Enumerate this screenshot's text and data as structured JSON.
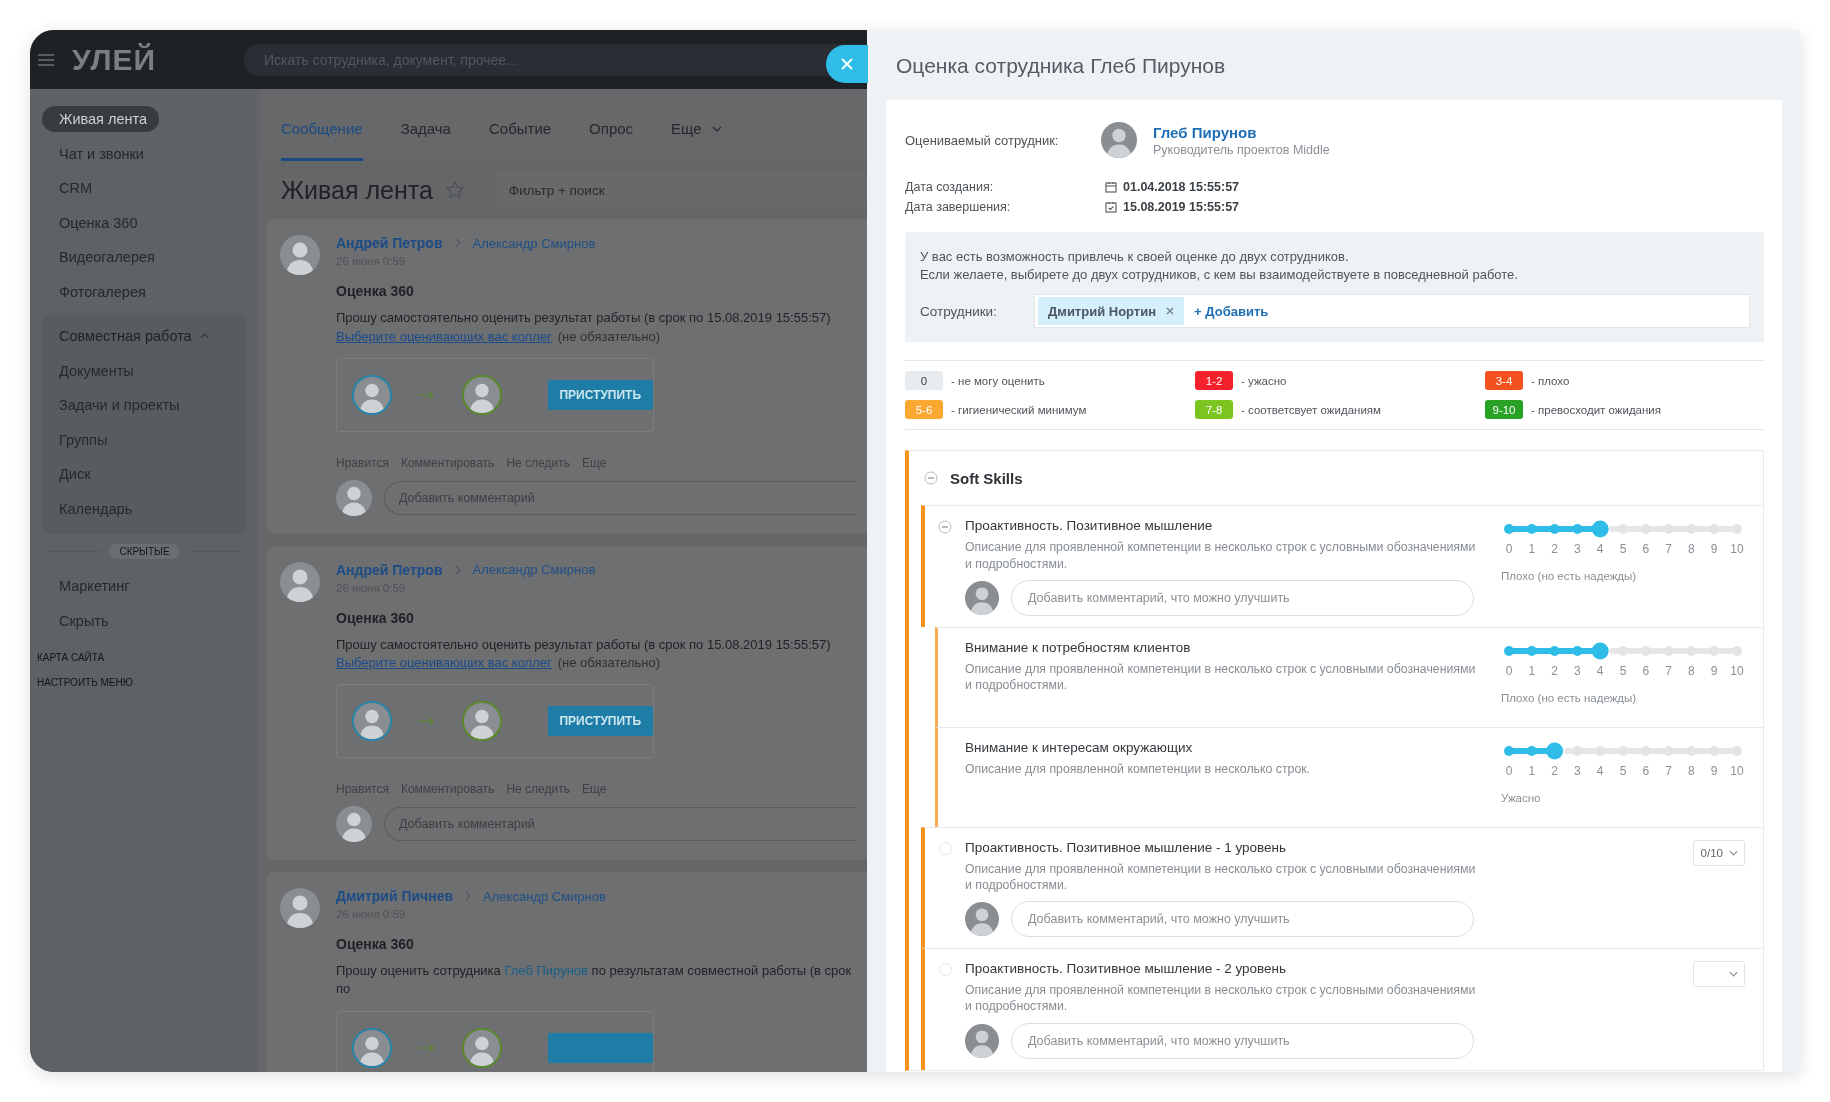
{
  "topbar": {
    "logo": "УЛЕЙ",
    "search_placeholder": "Искать сотрудника, документ, прочее..."
  },
  "sidebar": {
    "items": [
      {
        "label": "Живая лента",
        "selected": true
      },
      {
        "label": "Чат и звонки",
        "selected": false
      },
      {
        "label": "CRM",
        "selected": false
      },
      {
        "label": "Оценка 360",
        "selected": false
      },
      {
        "label": "Видеогалерея",
        "selected": false
      },
      {
        "label": "Фотогалерея",
        "selected": false
      }
    ],
    "group": {
      "label": "Совместная работа",
      "expanded": true,
      "children": [
        {
          "label": "Документы",
          "selected": false
        },
        {
          "label": "Задачи и проекты",
          "selected": false
        },
        {
          "label": "Группы",
          "selected": false
        },
        {
          "label": "Диск",
          "selected": false
        },
        {
          "label": "Календарь",
          "selected": false
        }
      ]
    },
    "divider": "СКРЫТЫЕ",
    "hidden_items": [
      {
        "label": "Маркетинг",
        "selected": false
      },
      {
        "label": "Скрыть",
        "selected": false
      }
    ],
    "footer_links": [
      "КАРТА САЙТА",
      "НАСТРОИТЬ МЕНЮ"
    ]
  },
  "composer_tabs": [
    {
      "label": "Сообщение",
      "selected": true,
      "menu": false
    },
    {
      "label": "Задача",
      "selected": false,
      "menu": false
    },
    {
      "label": "Событие",
      "selected": false,
      "menu": false
    },
    {
      "label": "Опрос",
      "selected": false,
      "menu": false
    },
    {
      "label": "Еще",
      "selected": false,
      "menu": true
    }
  ],
  "feed": {
    "title": "Живая лента",
    "starred": false,
    "filter_placeholder": "Фильтр + поиск",
    "posts": [
      {
        "author": "Андрей Петров",
        "recipient": "Александр Смирнов",
        "time": "26 июня 0:59",
        "title": "Оценка 360",
        "text": "Прошу самостоятельно оценить результат работы (в срок по 15.08.2019 15:55:57)",
        "link": "Выберите оценивающих вас коллег",
        "link_note": "(не обязательно)",
        "evaluation": true,
        "action": "ПРИСТУПИТЬ",
        "actions": [
          "Нравится",
          "Комментировать",
          "Не следить",
          "Еще"
        ],
        "comment_placeholder": "Добавить комментарий"
      },
      {
        "author": "Андрей Петров",
        "recipient": "Александр Смирнов",
        "time": "26 июня 0:59",
        "title": "Оценка 360",
        "text": "Прошу самостоятельно оценить результат работы (в срок по 15.08.2019 15:55:57)",
        "link": "Выберите оценивающих вас коллег",
        "link_note": "(не обязательно)",
        "evaluation": true,
        "action": "ПРИСТУПИТЬ",
        "actions": [
          "Нравится",
          "Комментировать",
          "Не следить",
          "Еще"
        ],
        "comment_placeholder": "Добавить комментарий"
      },
      {
        "author": "Дмитрий Пичнев",
        "recipient": "Александр Смирнов",
        "time": "26 июня 0:59",
        "title": "Оценка 360",
        "text": "Прошу оценить сотрудника",
        "text_link": "Глеб Пирунов",
        "text_end": "по результатам совместной работы (в срок по",
        "evaluation": true
      }
    ]
  },
  "review": {
    "title": "Оценка сотрудника Глеб Пирунов",
    "subject_label": "Оцениваемый сотрудник:",
    "subject": {
      "name": "Глеб Пирунов",
      "role": "Руководитель проектов Middle"
    },
    "dates": [
      {
        "kind": "created",
        "label": "Дата создания:",
        "value": "01.04.2018 15:55:57"
      },
      {
        "kind": "due",
        "label": "Дата завершения:",
        "value": "15.08.2019 15:55:57"
      }
    ],
    "invite": {
      "lines": [
        "У вас есть возможность привлечь к своей оценке до двух сотрудников.",
        "Если желаете, выбирете до двух сотрудников, с кем вы взаимодействуете в повседневной работе."
      ],
      "label": "Сотрудники:",
      "chips": [
        "Дмитрий Нортин"
      ],
      "add": "+ Добавить"
    },
    "legend": [
      {
        "badge": "0",
        "color": "#e8ecef",
        "text": "- не могу оценить"
      },
      {
        "badge": "1-2",
        "color": "#f5222d",
        "text": "- ужасно"
      },
      {
        "badge": "3-4",
        "color": "#f4511e",
        "text": "- плохо"
      },
      {
        "badge": "5-6",
        "color": "#fba833",
        "text": "- гигиенический минимум"
      },
      {
        "badge": "7-8",
        "color": "#7cc520",
        "text": "- соответсвует ожиданиям"
      },
      {
        "badge": "9-10",
        "color": "#28a125",
        "text": "- превосходит ожидания"
      }
    ],
    "sections": [
      {
        "title": "Soft Skills",
        "expanded": true,
        "items": [
          {
            "kind": "slider",
            "title": "Проактивность. Позитивное мышление",
            "description": "Описание для проявленной компетенции в несколько строк с условными обозначениями и подробностями.",
            "expanded": true,
            "level": 0.4,
            "ticks": [
              "0",
              "1",
              "2",
              "3",
              "4",
              "5",
              "6",
              "7",
              "8",
              "9",
              "10"
            ],
            "rating": "Плохо (но есть надежды)",
            "comment_placeholder": "Добавить комментарий, что можно улучшить",
            "children": [
              {
                "kind": "slider",
                "title": "Внимание к потребностям клиентов",
                "description": "Описание для проявленной компетенции в несколько строк с условными обозначениями и подробностями.",
                "level": 0.4,
                "ticks": [
                  "0",
                  "1",
                  "2",
                  "3",
                  "4",
                  "5",
                  "6",
                  "7",
                  "8",
                  "9",
                  "10"
                ],
                "rating": "Плохо (но есть надежды)"
              },
              {
                "kind": "slider",
                "title": "Внимание к интересам окружающих",
                "description": "Описание для проявленной компетенции в несколько строк.",
                "level": 0.2,
                "ticks": [
                  "0",
                  "1",
                  "2",
                  "3",
                  "4",
                  "5",
                  "6",
                  "7",
                  "8",
                  "9",
                  "10"
                ],
                "rating": "Ужасно"
              }
            ]
          },
          {
            "kind": "select",
            "title": "Проактивность. Позитивное мышление - 1 уровень",
            "description": "Описание для проявленной компетенции в несколько строк с условными обозначениями и подробностями.",
            "checked": false,
            "value": "0/10",
            "comment_placeholder": "Добавить комментарий, что можно улучшить"
          },
          {
            "kind": "select",
            "title": "Проактивность. Позитивное мышление - 2 уровень",
            "description": "Описание для проявленной компетенции в несколько строк с условными обозначениями и подробностями.",
            "checked": false,
            "comment_placeholder": "Добавить комментарий, что можно улучшить"
          }
        ]
      }
    ]
  }
}
